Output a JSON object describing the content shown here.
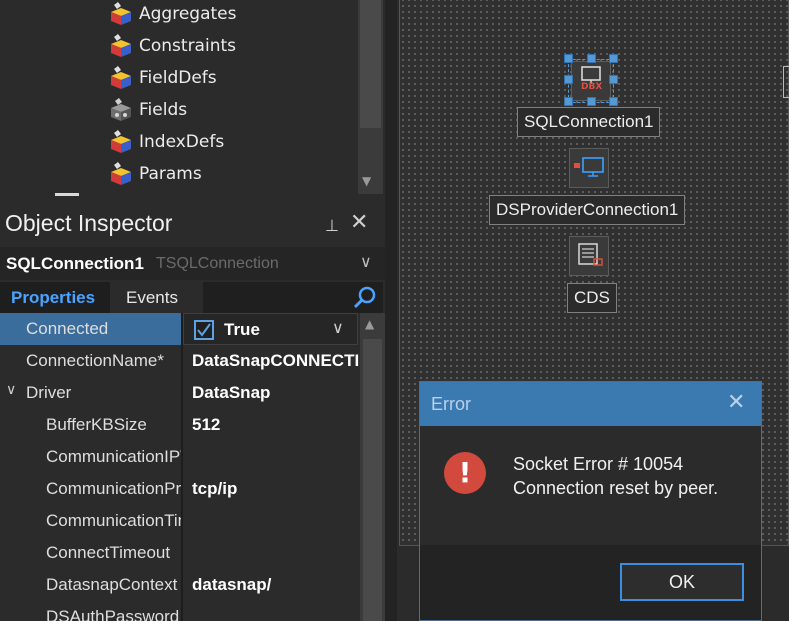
{
  "tree": {
    "items": [
      {
        "label": "Aggregates",
        "icon": "component-icon"
      },
      {
        "label": "Constraints",
        "icon": "component-icon"
      },
      {
        "label": "FieldDefs",
        "icon": "component-icon"
      },
      {
        "label": "Fields",
        "icon": "fields-icon"
      },
      {
        "label": "IndexDefs",
        "icon": "component-icon"
      },
      {
        "label": "Params",
        "icon": "component-icon"
      }
    ]
  },
  "inspector": {
    "title": "Object Inspector",
    "pin_glyph": "⊥",
    "close_glyph": "✕",
    "selected_name": "SQLConnection1",
    "selected_type": "TSQLConnection",
    "tabs": {
      "properties": "Properties",
      "events": "Events"
    },
    "search": {
      "placeholder": ""
    },
    "properties": [
      {
        "name": "Connected",
        "value": "True",
        "selected": true
      },
      {
        "name": "ConnectionName*",
        "value": "DataSnapCONNECTION"
      },
      {
        "name": "Driver",
        "value": "DataSnap",
        "expanded": true
      },
      {
        "name": "BufferKBSize",
        "value": "512"
      },
      {
        "name": "CommunicationIPVersion",
        "value": ""
      },
      {
        "name": "CommunicationProtocol",
        "value": "tcp/ip"
      },
      {
        "name": "CommunicationTimeout",
        "value": ""
      },
      {
        "name": "ConnectTimeout",
        "value": ""
      },
      {
        "name": "DatasnapContext",
        "value": "datasnap/"
      },
      {
        "name": "DSAuthPassword",
        "value": ""
      }
    ]
  },
  "designer": {
    "components": [
      {
        "label": "SQLConnection1",
        "icon": "dbx-icon",
        "badge": "DBX"
      },
      {
        "label": "DSProviderConnection1",
        "icon": "provider-icon"
      },
      {
        "label": "CDS",
        "icon": "clientdataset-icon"
      }
    ]
  },
  "dialog": {
    "title": "Error",
    "message_line1": "Socket Error # 10054",
    "message_line2": "Connection reset by peer.",
    "ok_label": "OK",
    "icon": "error-icon",
    "colors": {
      "title_bar": "#3b79b1",
      "icon": "#d24a3d",
      "button_border": "#3d8ee0"
    }
  },
  "colors": {
    "accent": "#4aa3ff",
    "selected_row": "#3b6d9c"
  }
}
